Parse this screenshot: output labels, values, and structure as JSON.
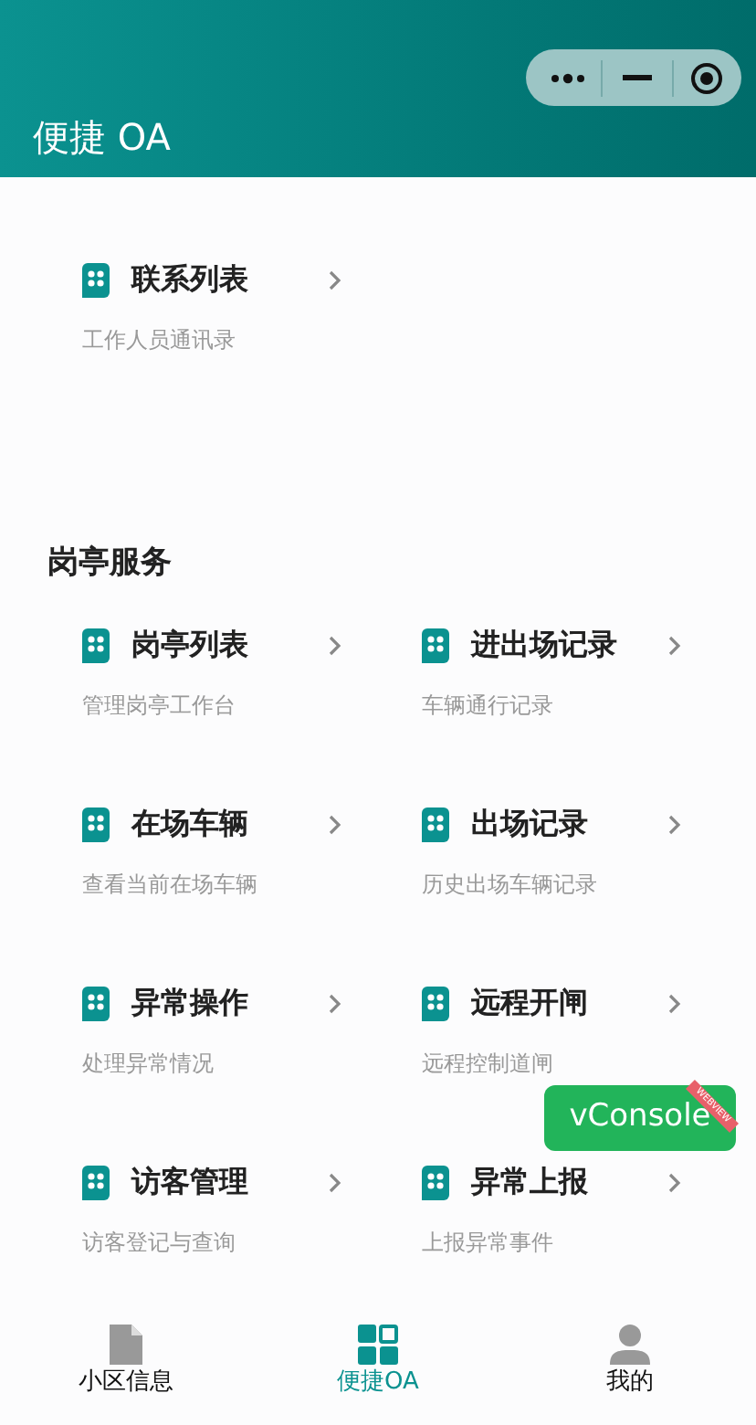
{
  "header": {
    "title": "便捷 OA"
  },
  "top_items": [
    {
      "title": "联系列表",
      "subtitle": "工作人员通讯录"
    }
  ],
  "section": {
    "title": "岗亭服务",
    "items": [
      {
        "title": "岗亭列表",
        "subtitle": "管理岗亭工作台"
      },
      {
        "title": "进出场记录",
        "subtitle": "车辆通行记录"
      },
      {
        "title": "在场车辆",
        "subtitle": "查看当前在场车辆"
      },
      {
        "title": "出场记录",
        "subtitle": "历史出场车辆记录"
      },
      {
        "title": "异常操作",
        "subtitle": "处理异常情况"
      },
      {
        "title": "远程开闸",
        "subtitle": "远程控制道闸"
      },
      {
        "title": "访客管理",
        "subtitle": "访客登记与查询"
      },
      {
        "title": "异常上报",
        "subtitle": "上报异常事件"
      }
    ]
  },
  "vconsole": {
    "label": "vConsole",
    "ribbon": "WEBVIEW"
  },
  "tabs": [
    {
      "kind": "doc",
      "label": "小区信息",
      "selected": false
    },
    {
      "kind": "grid",
      "label": "便捷OA",
      "selected": true
    },
    {
      "kind": "person",
      "label": "我的",
      "selected": false
    }
  ]
}
